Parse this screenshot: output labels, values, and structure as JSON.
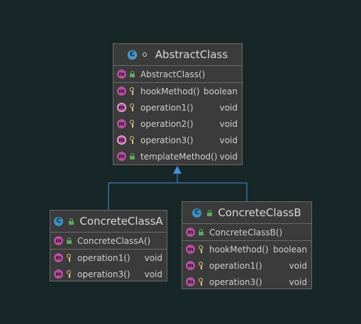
{
  "abstract_class": {
    "name": "AbstractClass",
    "type_icon": "abstract-class-icon",
    "constructors": [
      {
        "name": "AbstractClass()",
        "type": ""
      }
    ],
    "methods": [
      {
        "name": "hookMethod()",
        "type": "boolean",
        "visibility": "protected",
        "abstract": false
      },
      {
        "name": "operation1()",
        "type": "void",
        "visibility": "protected",
        "abstract": true
      },
      {
        "name": "operation2()",
        "type": "void",
        "visibility": "protected",
        "abstract": false
      },
      {
        "name": "operation3()",
        "type": "void",
        "visibility": "protected",
        "abstract": true
      },
      {
        "name": "templateMethod()",
        "type": "void",
        "visibility": "public",
        "abstract": false
      }
    ]
  },
  "concrete_a": {
    "name": "ConcreteClassA",
    "type_icon": "class-icon",
    "constructors": [
      {
        "name": "ConcreteClassA()",
        "type": ""
      }
    ],
    "methods": [
      {
        "name": "operation1()",
        "type": "void",
        "visibility": "protected"
      },
      {
        "name": "operation3()",
        "type": "void",
        "visibility": "protected"
      }
    ]
  },
  "concrete_b": {
    "name": "ConcreteClassB",
    "type_icon": "class-icon",
    "constructors": [
      {
        "name": "ConcreteClassB()",
        "type": ""
      }
    ],
    "methods": [
      {
        "name": "hookMethod()",
        "type": "boolean",
        "visibility": "protected"
      },
      {
        "name": "operation1()",
        "type": "void",
        "visibility": "protected"
      },
      {
        "name": "operation3()",
        "type": "void",
        "visibility": "protected"
      }
    ]
  },
  "colors": {
    "background": "#172627",
    "box": "#3b3b3b",
    "border": "#6b6b6b",
    "edge": "#4a90d9",
    "method_icon": "#b5509c",
    "class_icon": "#3d8fc6",
    "public": "#5fa85f",
    "protected": "#e8c27a"
  }
}
